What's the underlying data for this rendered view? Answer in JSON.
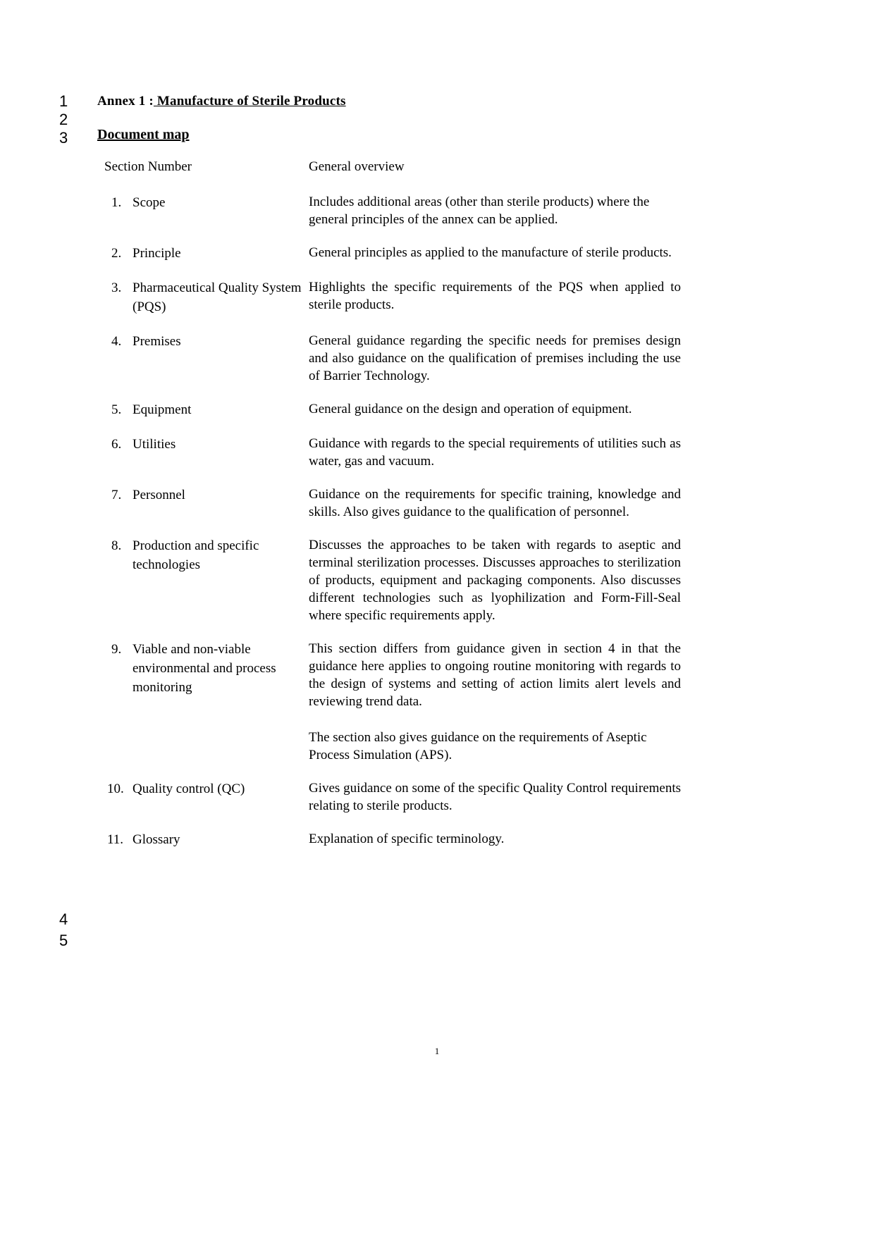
{
  "line_numbers": {
    "top": [
      "1",
      "2",
      "3"
    ],
    "bottom": [
      "4",
      "5"
    ]
  },
  "title": {
    "prefix": "Annex 1 :",
    "underlined": " Manufacture of Sterile Products"
  },
  "section_heading": "Document map",
  "table": {
    "headers": {
      "left": "Section Number",
      "right": "General overview"
    },
    "rows": [
      {
        "index": "1.",
        "label": "Scope",
        "paragraphs": [
          "Includes additional areas (other than sterile products) where the general principles of the annex can be applied."
        ],
        "justify": false
      },
      {
        "index": "2.",
        "label": "Principle",
        "paragraphs": [
          "General principles as applied to the manufacture of sterile products."
        ],
        "justify": true
      },
      {
        "index": "3.",
        "label": "Pharmaceutical Quality System (PQS)",
        "paragraphs": [
          "Highlights the specific requirements of the PQS when applied to sterile products."
        ],
        "justify": true
      },
      {
        "index": "4.",
        "label": "Premises",
        "paragraphs": [
          "General guidance regarding the specific needs for premises design and also guidance on the qualification of premises including the use of Barrier Technology."
        ],
        "justify": true
      },
      {
        "index": "5.",
        "label": "Equipment",
        "paragraphs": [
          "General guidance on the design and operation of equipment."
        ],
        "justify": false
      },
      {
        "index": "6.",
        "label": "Utilities",
        "paragraphs": [
          "Guidance with regards to the special requirements of utilities such as water, gas and vacuum."
        ],
        "justify": true
      },
      {
        "index": "7.",
        "label": "Personnel",
        "paragraphs": [
          "Guidance on the requirements for specific training, knowledge and skills. Also gives guidance to the qualification of personnel."
        ],
        "justify": true
      },
      {
        "index": "8.",
        "label": "Production and specific technologies",
        "paragraphs": [
          "Discusses the approaches to be taken with regards to aseptic and terminal sterilization processes. Discusses approaches to sterilization of products, equipment and packaging components. Also discusses different technologies such as lyophilization and Form-Fill-Seal where specific requirements apply."
        ],
        "justify": true
      },
      {
        "index": "9.",
        "label": "Viable and non-viable environmental and process monitoring",
        "paragraphs": [
          "This section differs from guidance given in section 4 in that the guidance here applies to ongoing routine monitoring with regards to the design of systems and setting of action limits alert levels and reviewing trend data.",
          "The section also gives guidance on the requirements of Aseptic Process Simulation (APS)."
        ],
        "justify": true
      },
      {
        "index": "10.",
        "label": "Quality control (QC)",
        "paragraphs": [
          "Gives guidance on some of the specific Quality Control requirements relating to sterile products."
        ],
        "justify": true
      },
      {
        "index": "11.",
        "label": "Glossary",
        "paragraphs": [
          "Explanation of specific terminology."
        ],
        "justify": false
      }
    ]
  },
  "footer": {
    "page_number": "1"
  }
}
